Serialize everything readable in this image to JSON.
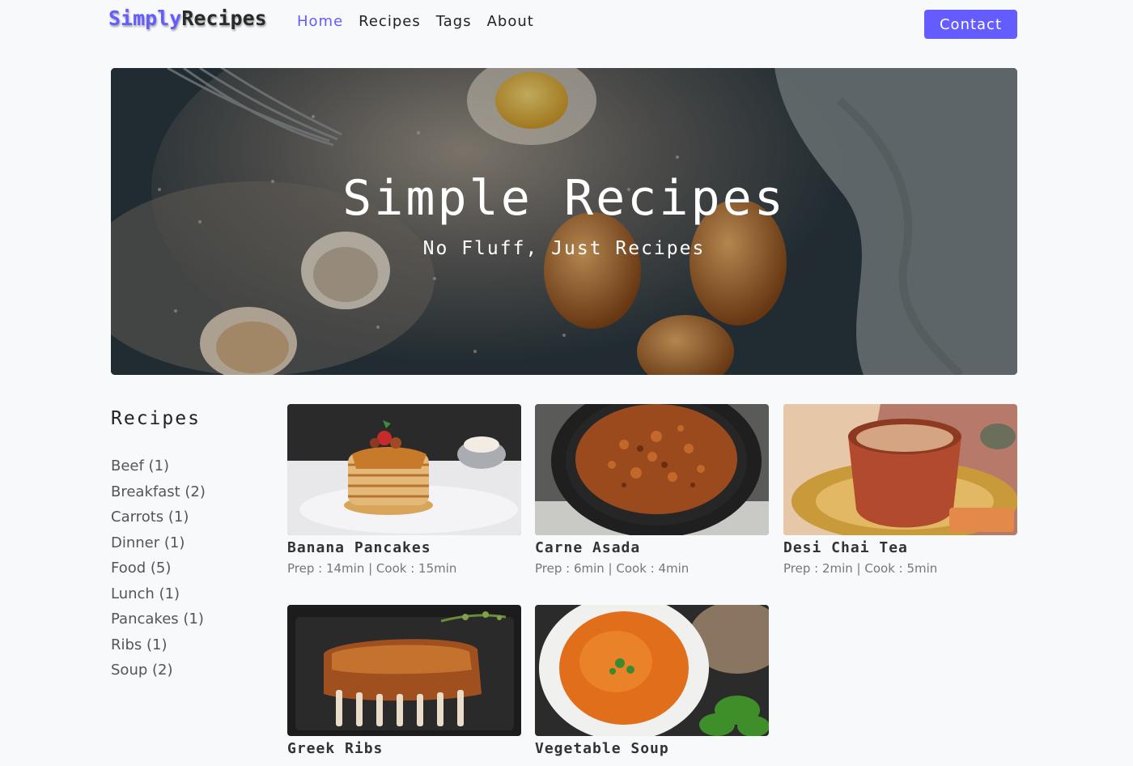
{
  "brand": {
    "part1": "Simply",
    "part2": "Recipes"
  },
  "nav": {
    "links": [
      "Home",
      "Recipes",
      "Tags",
      "About"
    ],
    "active": "Home",
    "contact_label": "Contact"
  },
  "colors": {
    "accent": "#645cff",
    "text": "#222222",
    "muted": "#777777"
  },
  "hero": {
    "title": "Simple Recipes",
    "subtitle": "No Fluff, Just Recipes"
  },
  "sidebar": {
    "title": "Recipes",
    "tags": [
      "Beef (1)",
      "Breakfast (2)",
      "Carrots (1)",
      "Dinner (1)",
      "Food (5)",
      "Lunch (1)",
      "Pancakes (1)",
      "Ribs (1)",
      "Soup (2)"
    ]
  },
  "recipes": [
    {
      "name": "Banana Pancakes",
      "meta": "Prep : 14min | Cook : 15min",
      "icon": "pancakes-photo"
    },
    {
      "name": "Carne Asada",
      "meta": "Prep : 6min | Cook : 4min",
      "icon": "carne-asada-photo"
    },
    {
      "name": "Desi Chai Tea",
      "meta": "Prep : 2min | Cook : 5min",
      "icon": "chai-photo"
    },
    {
      "name": "Greek Ribs",
      "meta": "",
      "icon": "ribs-photo"
    },
    {
      "name": "Vegetable Soup",
      "meta": "",
      "icon": "soup-photo"
    }
  ]
}
